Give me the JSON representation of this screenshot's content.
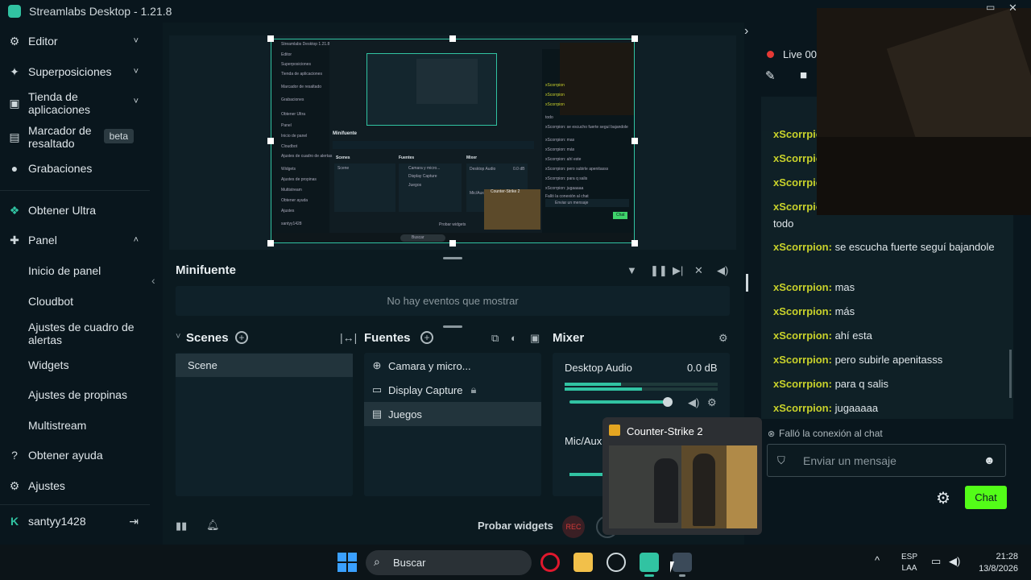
{
  "window": {
    "title": "Streamlabs Desktop - 1.21.8"
  },
  "sidebar": {
    "items": [
      {
        "label": "Editor",
        "icon": "editor-icon",
        "chevron": "˅"
      },
      {
        "label": "Superposiciones",
        "icon": "overlays-icon",
        "chevron": "˅"
      },
      {
        "label": "Tienda de aplicaciones",
        "icon": "store-icon",
        "chevron": "˅"
      },
      {
        "label": "Marcador de resaltado",
        "icon": "highlighter-icon",
        "badge": "beta"
      },
      {
        "label": "Grabaciones",
        "icon": "recordings-icon"
      },
      {
        "label": "Obtener Ultra",
        "icon": "ultra-icon"
      },
      {
        "label": "Panel",
        "icon": "dashboard-icon",
        "chevron": "˄"
      }
    ],
    "sub_items": [
      "Inicio de panel",
      "Cloudbot",
      "Ajustes de cuadro de alertas",
      "Widgets",
      "Ajustes de propinas",
      "Multistream"
    ],
    "help": "Obtener ayuda",
    "settings": "Ajustes",
    "user": "santyy1428"
  },
  "mini_source": {
    "title": "Minifuente",
    "empty": "No hay eventos que mostrar"
  },
  "scenes": {
    "title": "Scenes",
    "items": [
      "Scene"
    ]
  },
  "sources": {
    "title": "Fuentes",
    "items": [
      "Camara y micro...",
      "Display Capture",
      "Juegos"
    ]
  },
  "mixer": {
    "title": "Mixer",
    "channels": [
      {
        "name": "Desktop Audio",
        "level": "0.0 dB",
        "volume": 0.96
      },
      {
        "name": "Mic/Aux"
      }
    ]
  },
  "bottom_bar": {
    "test_widgets": "Probar widgets",
    "rec": "REC"
  },
  "popup": {
    "title": "Counter-Strike 2"
  },
  "right_panel": {
    "live": "Live 00"
  },
  "chat": {
    "messages": [
      {
        "user": "xScorrpion",
        "text": ""
      },
      {
        "user": "xScorrpion",
        "text": ""
      },
      {
        "user": "xScorrpion",
        "text": ""
      },
      {
        "user": "xScorrpion",
        "text": "todo"
      },
      {
        "user": "xScorrpion",
        "text": "se escucha fuerte seguí bajandole"
      },
      {
        "user": "xScorrpion",
        "text": "mas"
      },
      {
        "user": "xScorrpion",
        "text": "más"
      },
      {
        "user": "xScorrpion",
        "text": "ahí esta"
      },
      {
        "user": "xScorrpion",
        "text": "pero subirle apenitasss"
      },
      {
        "user": "xScorrpion",
        "text": "para q salis"
      },
      {
        "user": "xScorrpion",
        "text": "jugaaaaa"
      }
    ],
    "error": "Falló la conexión al chat",
    "placeholder": "Enviar un mensaje",
    "send": "Chat"
  },
  "mini_screenshot": {
    "title": "Streamlabs Desktop 1.21.8",
    "nav": [
      "Editor",
      "Superposiciones",
      "Tienda de aplicaciones",
      "Marcador de resaltado",
      "Grabaciones",
      "Obtener Ultra",
      "Panel",
      "Inicio de panel",
      "Cloudbot",
      "Ajustes de cuadro de alertas",
      "Widgets",
      "Ajustes de propinas",
      "Multistream",
      "Obtener ayuda",
      "Ajustes",
      "santyy1428"
    ],
    "minifuente": "Minifuente",
    "scenes": "Scenes",
    "scene_item": "Scene",
    "fuentes": "Fuentes",
    "sources": [
      "Camara y micro...",
      "Display Capture",
      "Juegos"
    ],
    "mixer": "Mixer",
    "desktop_audio": "Desktop Audio",
    "db": "0.0 dB",
    "mic": "Mic/Aux",
    "probar": "Probar widgets",
    "buscar": "Buscar",
    "cs2": "Counter-Strike 2",
    "chat_lines": [
      "xScorrpion",
      "xScorrpion",
      "xScorrpion",
      "todo",
      "xScorrpion: se escucho fuerte seguí bajandole",
      "xScorrpion: mas",
      "xScorrpion: más",
      "xScorrpion: ahí este",
      "xScorrpion: pero subirle apenitasss",
      "xScorrpion: para q salis",
      "xScorrpion: jugaaaaa"
    ],
    "chat_placeholder": "Enviar un mensaje",
    "chat_send": "Chat",
    "error": "Falló la conexión al chat"
  },
  "taskbar": {
    "search": "Buscar",
    "lang": "ESP",
    "layout": "LAA",
    "time": "21:28",
    "date": "13/8/2026"
  },
  "colors": {
    "accent": "#31c3a2",
    "chat_user": "#c9d22b",
    "rec": "#d33a3a",
    "live_dot": "#e53935"
  }
}
